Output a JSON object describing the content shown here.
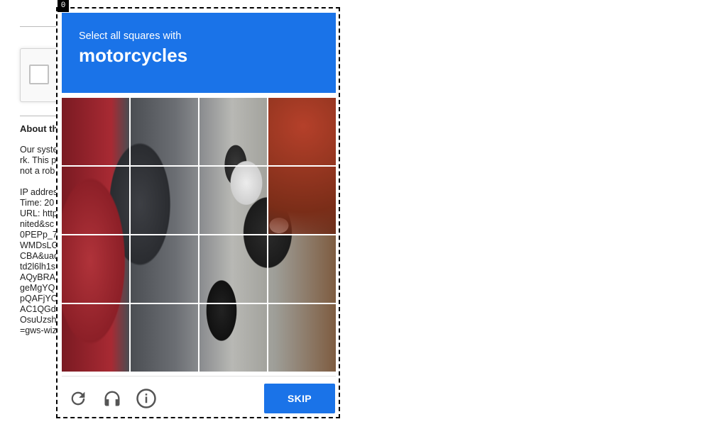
{
  "background": {
    "about_title": "About th",
    "info_lines": [
      "Our syste",
      "rk. This p",
      "not a rob",
      "",
      "IP addres",
      "Time: 20",
      "URL: http",
      "nited&sc",
      "0PEPp_7",
      "WMDsLG",
      "CBA&uad",
      "td2l6lh1s",
      "AQyBRA",
      "geMgYQ",
      "pQAFjYC",
      "AC1QGd",
      "OsuUzsh",
      "=gws-wiz"
    ]
  },
  "challenge": {
    "badge": "0",
    "instruction": "Select all squares with",
    "object": "motorcycles",
    "tiles_count": 16,
    "skip_label": "SKIP",
    "icons": [
      "reload-icon",
      "headphones-icon",
      "info-icon"
    ],
    "colors": {
      "header": "#1a73e8",
      "skip_button": "#1a73e8"
    }
  }
}
